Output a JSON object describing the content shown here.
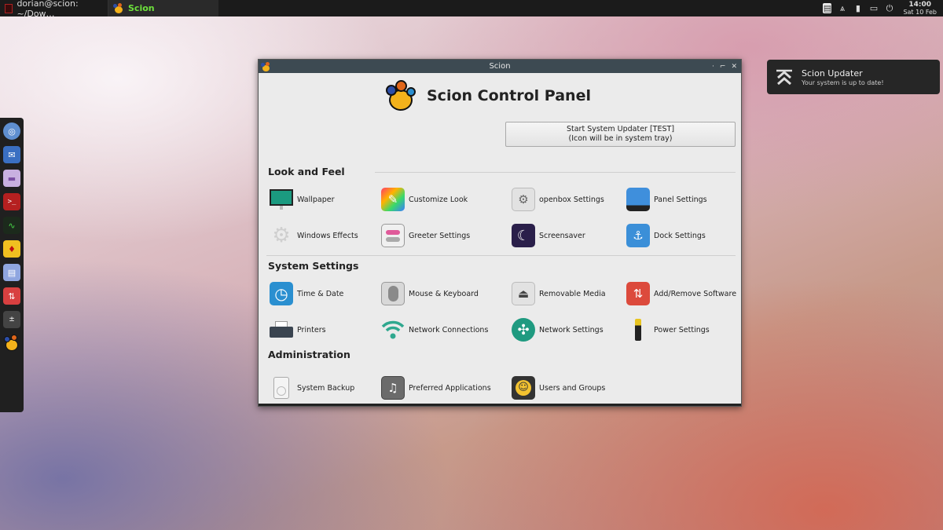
{
  "taskbar": {
    "tasks": [
      {
        "label": "dorian@scion: ~/Dow…",
        "icon": "terminal-icon"
      },
      {
        "label": "Scion",
        "icon": "scion-icon"
      }
    ],
    "clock": {
      "time": "14:00",
      "date": "Sat 10 Feb"
    },
    "tray_icons": [
      "clipboard-icon",
      "updater-icon",
      "battery-icon",
      "display-icon",
      "power-icon"
    ]
  },
  "dock": {
    "items": [
      "web-browser-icon",
      "mail-icon",
      "file-manager-icon",
      "terminal-icon",
      "system-monitor-icon",
      "games-icon",
      "text-editor-icon",
      "software-icon",
      "calculator-icon",
      "scion-icon"
    ]
  },
  "notification": {
    "title": "Scion Updater",
    "body": "Your system is up to date!"
  },
  "window": {
    "title": "Scion",
    "controls": [
      "minimize",
      "maximize",
      "close"
    ],
    "header": "Scion Control Panel",
    "updater_button": {
      "line1": "Start System Updater [TEST]",
      "line2": "(Icon will be in system tray)"
    },
    "sections": [
      {
        "title": "Look and Feel",
        "items": [
          {
            "label": "Wallpaper",
            "icon": "wallpaper-icon"
          },
          {
            "label": "Customize Look",
            "icon": "customize-look-icon"
          },
          {
            "label": "openbox Settings",
            "icon": "openbox-settings-icon"
          },
          {
            "label": "Panel Settings",
            "icon": "panel-settings-icon"
          },
          {
            "label": "Windows Effects",
            "icon": "windows-effects-icon"
          },
          {
            "label": "Greeter Settings",
            "icon": "greeter-settings-icon"
          },
          {
            "label": "Screensaver",
            "icon": "screensaver-icon"
          },
          {
            "label": "Dock Settings",
            "icon": "dock-settings-icon"
          }
        ]
      },
      {
        "title": "System Settings",
        "items": [
          {
            "label": "Time & Date",
            "icon": "clock-icon"
          },
          {
            "label": "Mouse & Keyboard",
            "icon": "mouse-icon"
          },
          {
            "label": "Removable Media",
            "icon": "eject-icon"
          },
          {
            "label": "Add/Remove Software",
            "icon": "software-icon"
          },
          {
            "label": "Printers",
            "icon": "printer-icon"
          },
          {
            "label": "Network Connections",
            "icon": "wifi-icon"
          },
          {
            "label": "Network Settings",
            "icon": "globe-icon"
          },
          {
            "label": "Power Settings",
            "icon": "battery-icon"
          }
        ]
      },
      {
        "title": "Administration",
        "items": [
          {
            "label": "System Backup",
            "icon": "backup-icon"
          },
          {
            "label": "Preferred Applications",
            "icon": "preferred-apps-icon"
          },
          {
            "label": "Users and Groups",
            "icon": "users-icon"
          }
        ]
      }
    ]
  },
  "colors": {
    "accent_green": "#6ee23c",
    "titlebar": "#3d4a52",
    "window_bg": "#ebebeb",
    "panel_bg": "#1b1b1b"
  }
}
